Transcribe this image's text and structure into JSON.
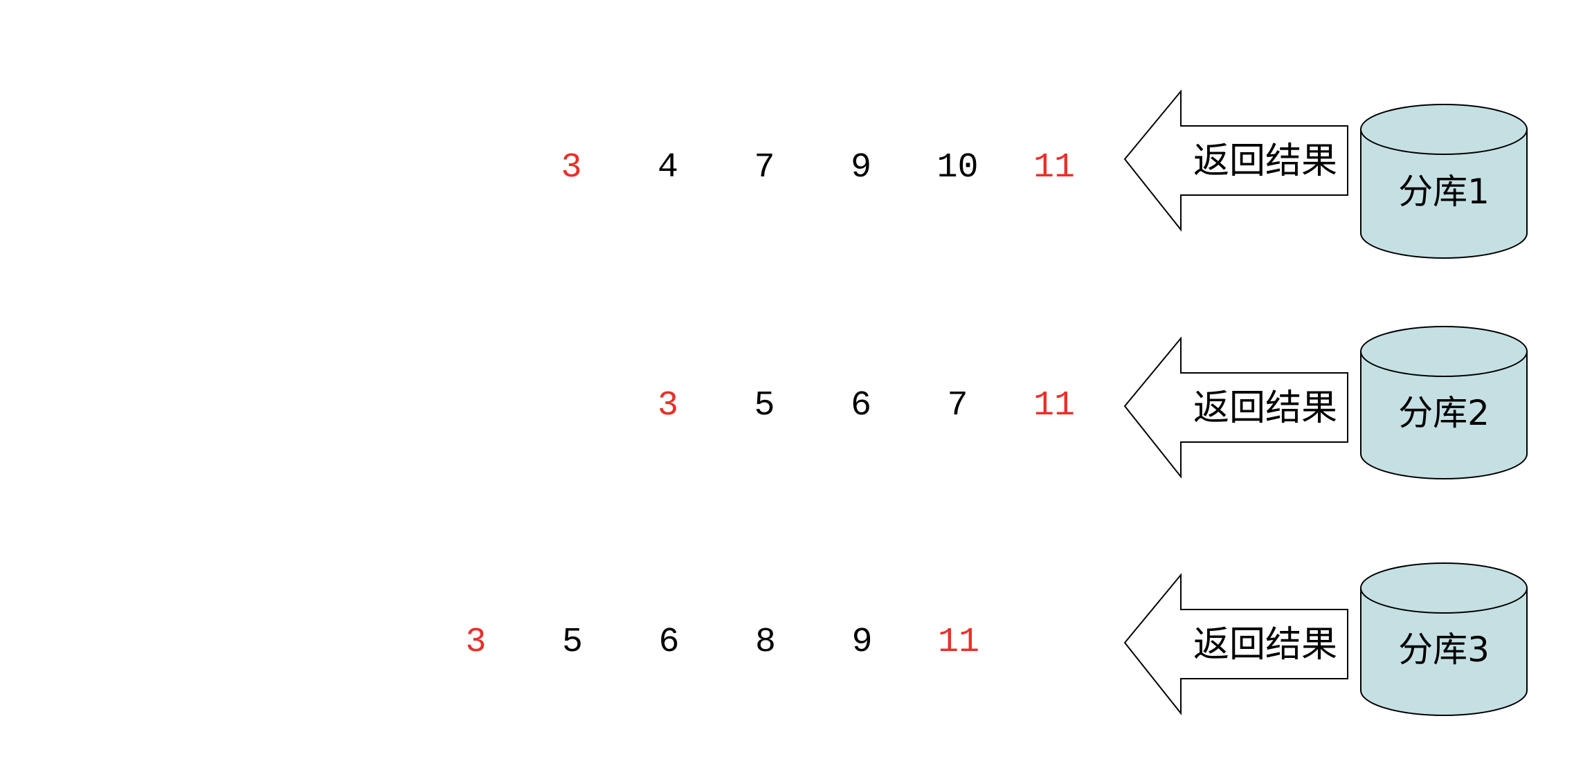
{
  "colors": {
    "highlight": "#e8302a",
    "normal": "#000000",
    "cylinder_fill": "#c5e0e3"
  },
  "rows": [
    {
      "values": [
        {
          "text": "3",
          "highlight": true
        },
        {
          "text": "4",
          "highlight": false
        },
        {
          "text": "7",
          "highlight": false
        },
        {
          "text": "9",
          "highlight": false
        },
        {
          "text": "10",
          "highlight": false
        },
        {
          "text": "11",
          "highlight": true
        }
      ],
      "arrow_label": "返回结果",
      "db_label": "分库1"
    },
    {
      "values": [
        {
          "text": "3",
          "highlight": true
        },
        {
          "text": "5",
          "highlight": false
        },
        {
          "text": "6",
          "highlight": false
        },
        {
          "text": "7",
          "highlight": false
        },
        {
          "text": "11",
          "highlight": true
        }
      ],
      "arrow_label": "返回结果",
      "db_label": "分库2"
    },
    {
      "values": [
        {
          "text": "3",
          "highlight": true
        },
        {
          "text": "5",
          "highlight": false
        },
        {
          "text": "6",
          "highlight": false
        },
        {
          "text": "8",
          "highlight": false
        },
        {
          "text": "9",
          "highlight": false
        },
        {
          "text": "11",
          "highlight": true
        }
      ],
      "arrow_label": "返回结果",
      "db_label": "分库3"
    }
  ]
}
